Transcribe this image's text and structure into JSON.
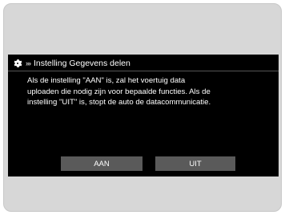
{
  "dialog": {
    "title": "Instelling Gegevens delen",
    "header_icons": [
      "gear-icon",
      "chevrons-right-icon"
    ],
    "message_lines": [
      "Als de instelling \"AAN\" is, zal het voertuig data",
      "uploaden die nodig zijn voor bepaalde functies. Als de",
      "instelling \"UIT\" is, stopt de auto de datacommunicatie."
    ],
    "buttons": {
      "on_label": "AAN",
      "off_label": "UIT"
    }
  },
  "colors": {
    "screen_background": "#000000",
    "bezel": "#d7d7d7",
    "button": "#5a5a5a",
    "text": "#ffffff"
  }
}
